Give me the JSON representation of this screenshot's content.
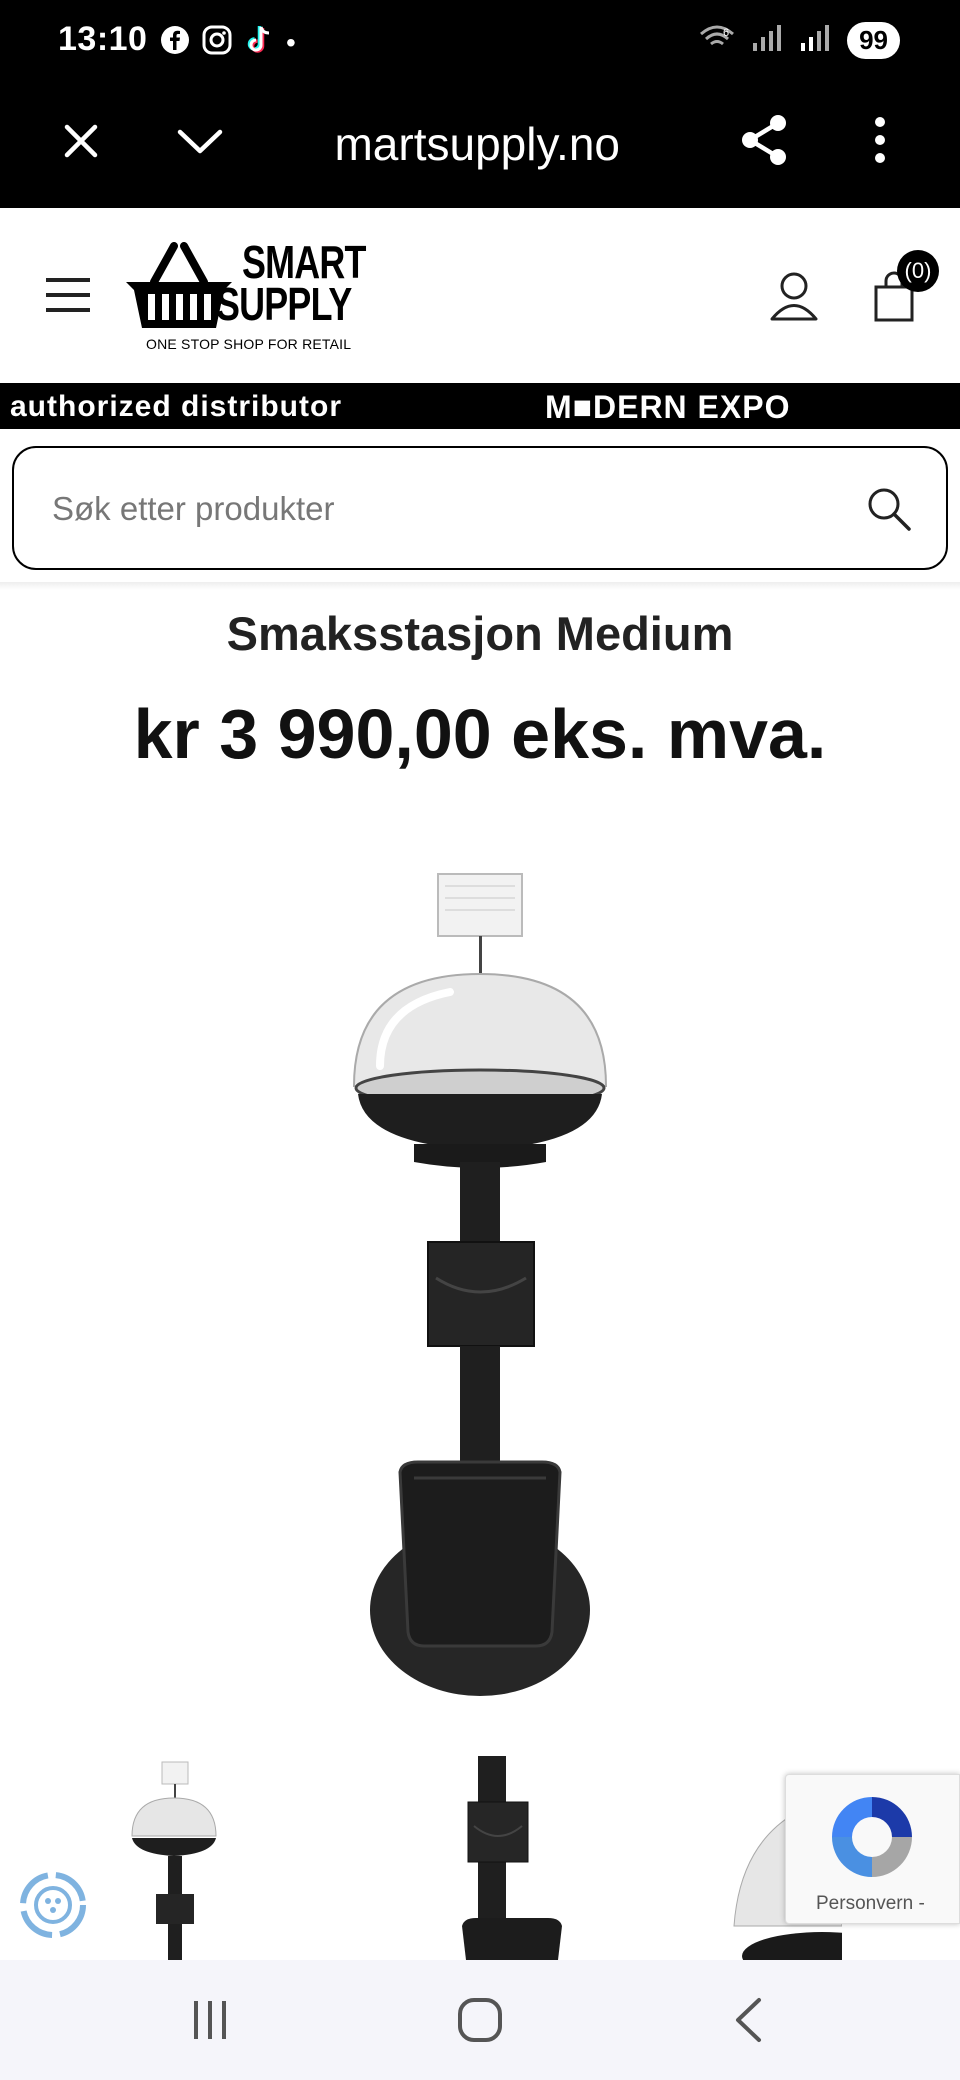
{
  "status_bar": {
    "time": "13:10",
    "notification_icons": [
      "facebook-icon",
      "instagram-icon",
      "tiktok-icon"
    ],
    "network": "wifi-icon",
    "battery": "99"
  },
  "browser": {
    "url": "martsupply.no",
    "close_icon": "close-icon",
    "dropdown_icon": "chevron-down-icon",
    "share_icon": "share-icon",
    "menu_icon": "more-vert-icon"
  },
  "site_header": {
    "logo_line1": "SMART",
    "logo_line2": "SUPPLY",
    "tagline": "ONE STOP SHOP FOR RETAIL",
    "cart_count": "(0)"
  },
  "banner": {
    "left_text": "authorized distributor",
    "right_text": "M■DERN EXPO"
  },
  "search": {
    "placeholder": "Søk etter produkter"
  },
  "product": {
    "title": "Smaksstasjon Medium",
    "price": "kr 3 990,00 eks. mva."
  },
  "recaptcha": {
    "label": "Personvern -"
  },
  "colors": {
    "black": "#000000",
    "text": "#222222",
    "nav_bg": "#f5f5fa"
  }
}
